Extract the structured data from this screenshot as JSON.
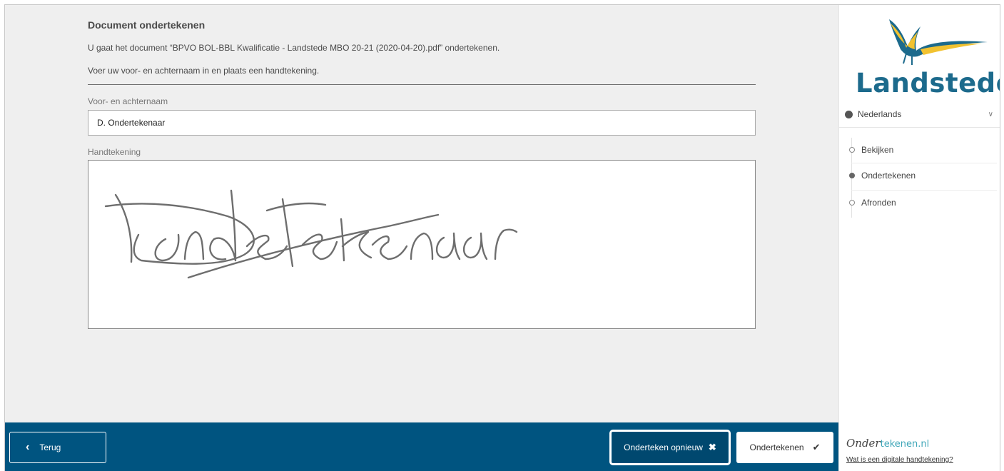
{
  "document": {
    "title": "Document ondertekenen",
    "description": "U gaat het document “BPVO BOL-BBL Kwalificatie - Landstede MBO 20-21 (2020-04-20).pdf” ondertekenen.",
    "instruction": "Voer uw voor- en achternaam in en plaats een handtekening."
  },
  "form": {
    "name_label": "Voor- en achternaam",
    "name_value": "D. Ondertekenaar",
    "signature_label": "Handtekening"
  },
  "footer": {
    "back_label": "Terug",
    "retry_label": "Onderteken opnieuw",
    "sign_label": "Ondertekenen"
  },
  "sidebar": {
    "logo_text": "Landstede",
    "language": "Nederlands",
    "steps": [
      {
        "label": "Bekijken",
        "active": false
      },
      {
        "label": "Ondertekenen",
        "active": true
      },
      {
        "label": "Afronden",
        "active": false
      }
    ],
    "brand_dark": "Onder",
    "brand_light": "tekenen.nl",
    "help_link": "Wat is een digitale handtekening?"
  },
  "colors": {
    "footer_bg": "#005480",
    "logo_blue": "#1c6a8c",
    "logo_yellow": "#f2c230",
    "main_bg": "#efefef"
  },
  "icons": {
    "back": "chevron-left-icon",
    "retry": "close-icon",
    "sign": "checkmark-icon",
    "language": "globe-icon",
    "language_toggle": "chevron-down-icon"
  }
}
